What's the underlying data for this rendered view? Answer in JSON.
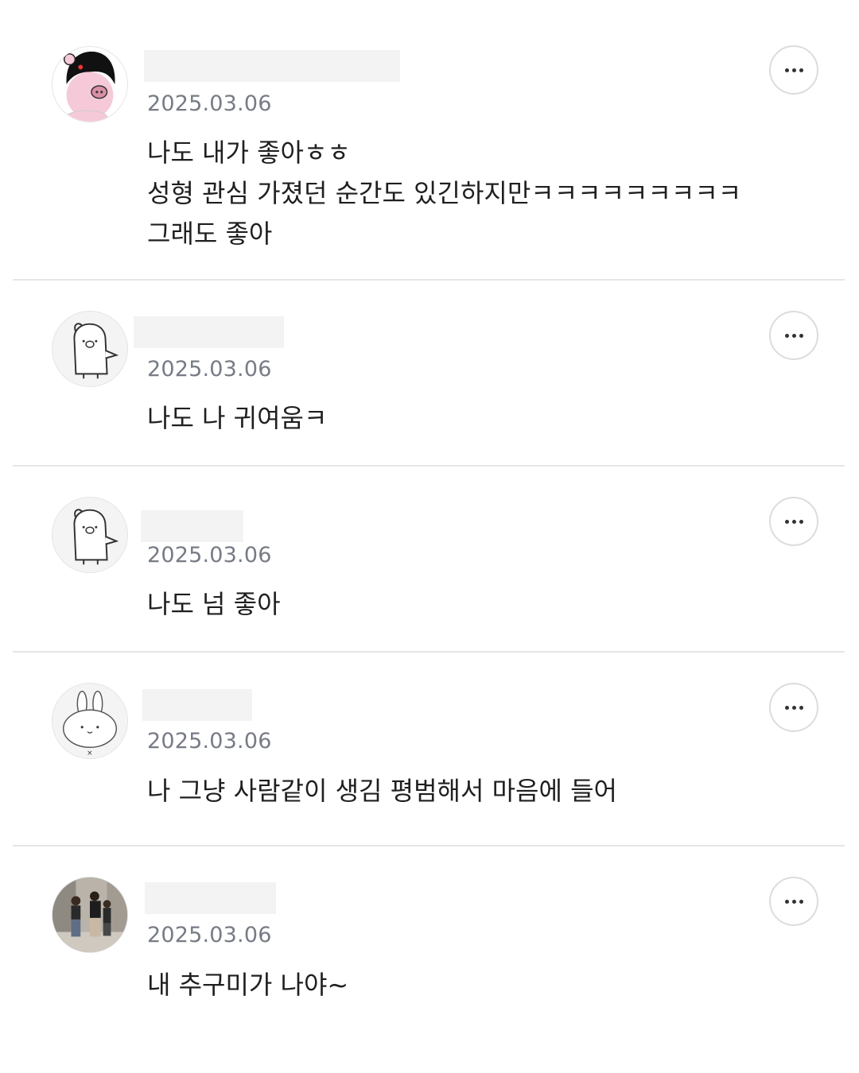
{
  "comments": [
    {
      "avatar_icon": "girl-pig-character-icon",
      "date": "2025.03.06",
      "text": "나도 내가 좋아ㅎㅎ\n성형 관심 가졌던 순간도 있긴하지만ㅋㅋㅋㅋㅋㅋㅋㅋㅋ\n그래도 좋아",
      "more_icon": "more-options-icon"
    },
    {
      "avatar_icon": "pig-character-outline-icon",
      "date": "2025.03.06",
      "text": "나도 나 귀여움ㅋ",
      "more_icon": "more-options-icon"
    },
    {
      "avatar_icon": "pig-character-outline-icon",
      "date": "2025.03.06",
      "text": "나도 넘 좋아",
      "more_icon": "more-options-icon"
    },
    {
      "avatar_icon": "bunny-character-icon",
      "date": "2025.03.06",
      "text": "나 그냥 사람같이 생김 평범해서 마음에 들어",
      "more_icon": "more-options-icon"
    },
    {
      "avatar_icon": "photo-people-avatar-icon",
      "date": "2025.03.06",
      "text": "내 추구미가 나야~",
      "more_icon": "more-options-icon"
    }
  ]
}
